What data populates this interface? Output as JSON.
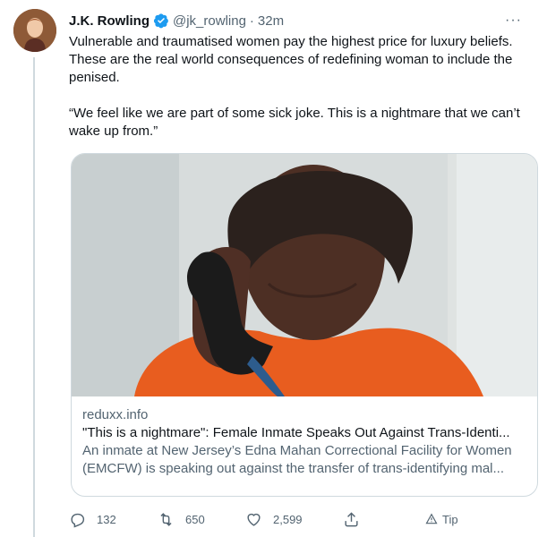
{
  "tweet": {
    "author_name": "J.K. Rowling",
    "handle": "@jk_rowling",
    "separator": "·",
    "time": "32m",
    "more": "···",
    "text": "Vulnerable and traumatised women pay the highest price for luxury beliefs. These are the real world consequences of redefining woman to include the penised.\n\n“We feel like we are part of some sick joke. This is a nightmare that we can’t wake up from.”"
  },
  "card": {
    "domain": "reduxx.info",
    "title": "\"This is a nightmare\": Female Inmate Speaks Out Against Trans-Identi...",
    "description": "An inmate at New Jersey’s Edna Mahan Correctional Facility for Women (EMCFW) is speaking out against the transfer of trans-identifying mal..."
  },
  "actions": {
    "replies": "132",
    "retweets": "650",
    "likes": "2,599",
    "tip_label": "Tip"
  },
  "icons": {
    "verified": "verified-badge-icon",
    "reply": "reply-icon",
    "retweet": "retweet-icon",
    "like": "heart-icon",
    "share": "share-icon",
    "tip": "tip-icon"
  },
  "colors": {
    "verified": "#1d9bf0",
    "text": "#0f1419",
    "secondary": "#536471",
    "border": "#cfd9de"
  }
}
